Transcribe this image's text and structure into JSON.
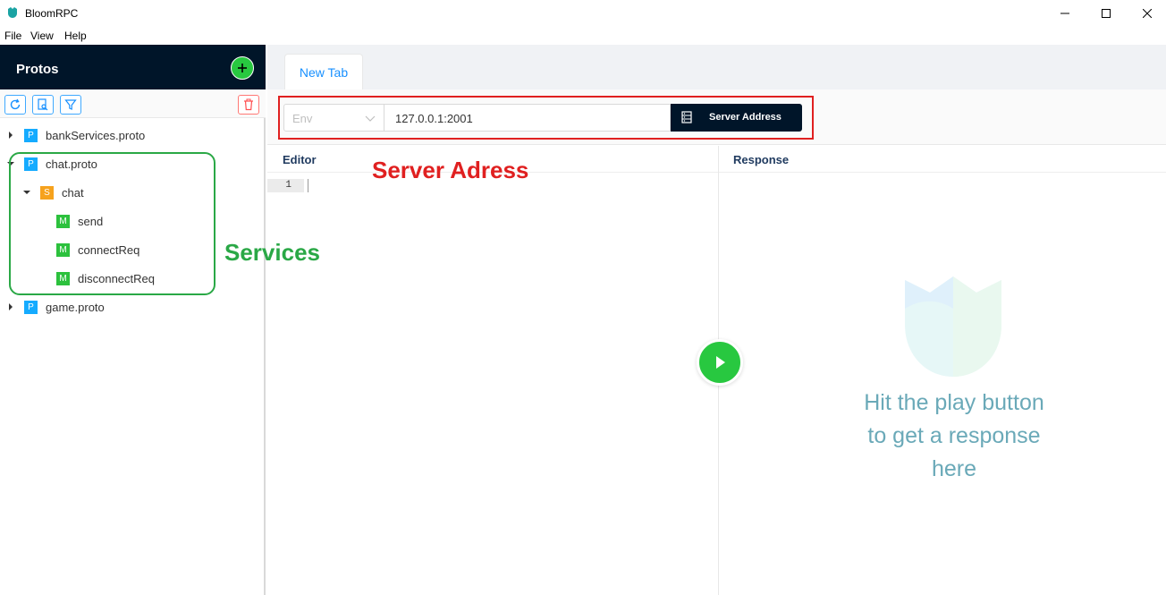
{
  "window": {
    "title": "BloomRPC"
  },
  "menu": [
    "File",
    "View",
    "Help"
  ],
  "sidebar": {
    "title": "Protos",
    "tree": [
      {
        "label": "bankServices.proto",
        "badge": "P",
        "expanded": false
      },
      {
        "label": "chat.proto",
        "badge": "P",
        "expanded": true
      },
      {
        "label": "chat",
        "badge": "S",
        "expanded": true
      },
      {
        "label": "send",
        "badge": "M"
      },
      {
        "label": "connectReq",
        "badge": "M"
      },
      {
        "label": "disconnectReq",
        "badge": "M"
      },
      {
        "label": "game.proto",
        "badge": "P",
        "expanded": false
      }
    ]
  },
  "annotations": {
    "services": "Services",
    "server": "Server Adress"
  },
  "tabs": [
    {
      "label": "New Tab",
      "active": true
    }
  ],
  "address_bar": {
    "env_placeholder": "Env",
    "address": "127.0.0.1:2001",
    "button_label": "Server Address"
  },
  "editor": {
    "title": "Editor",
    "line_number": "1"
  },
  "response": {
    "title": "Response",
    "hint_lines": [
      "Hit the play button",
      "to get a response",
      "here"
    ]
  },
  "colors": {
    "brand_dark": "#001529",
    "accent_green": "#28c840",
    "annotation_red": "#e02020",
    "annotation_green": "#2aa846",
    "proto_badge": "#15abff",
    "service_badge": "#f6a21d",
    "method_badge": "#2cc13d"
  }
}
